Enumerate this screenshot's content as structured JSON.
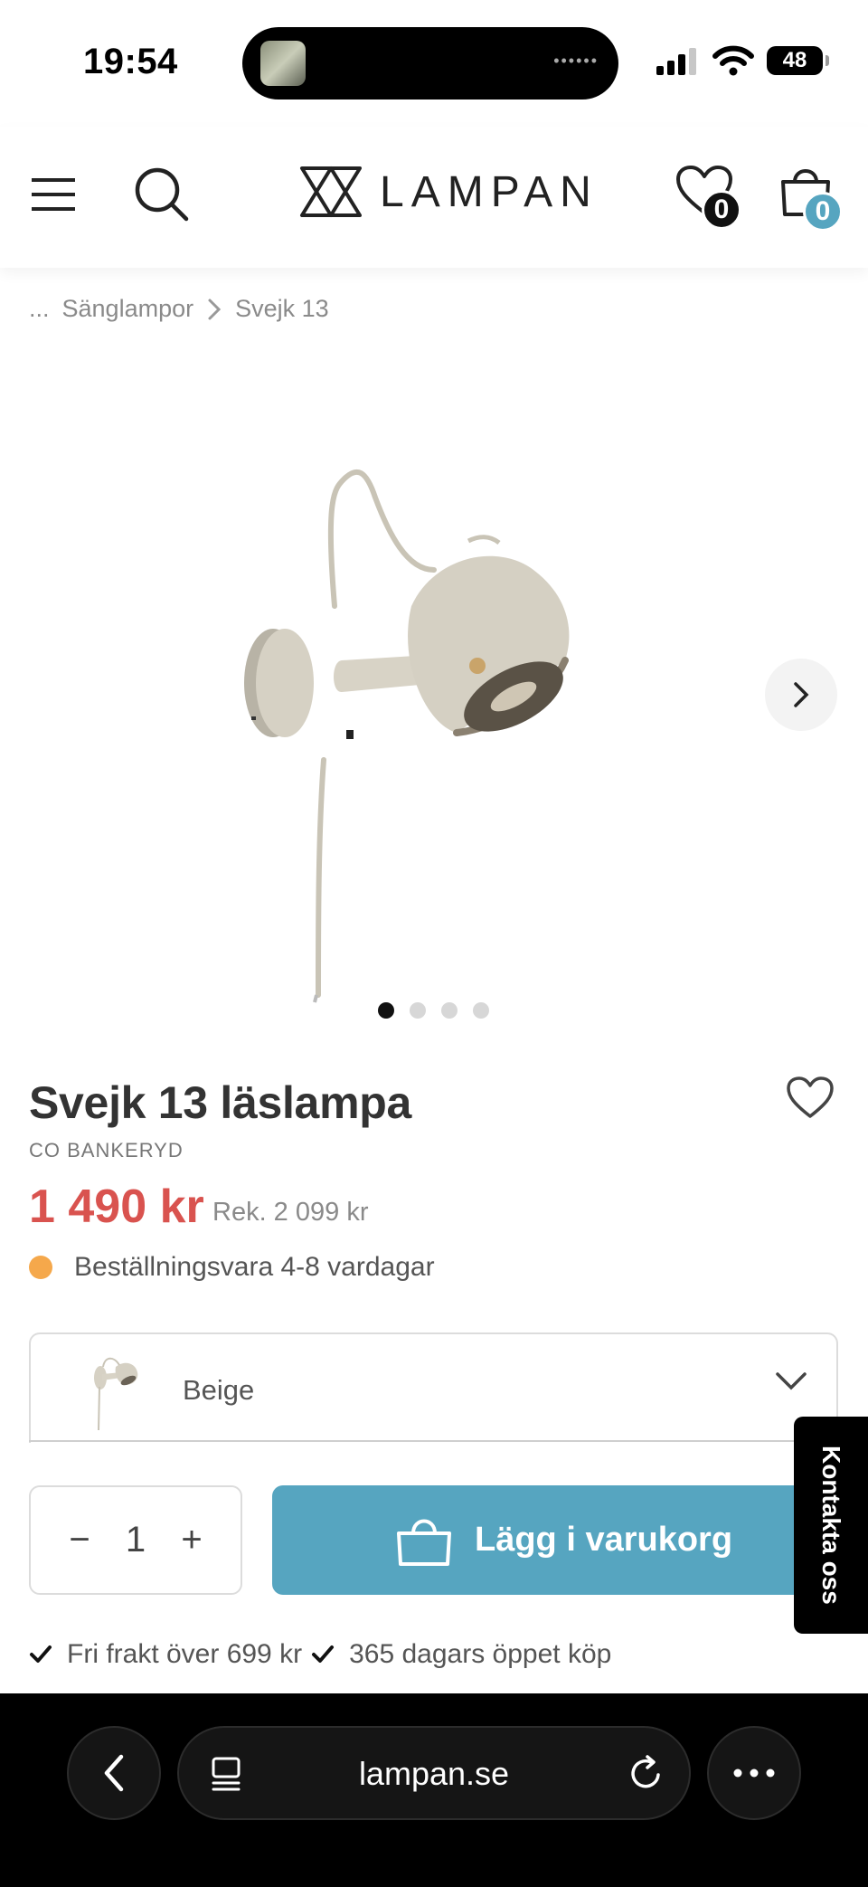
{
  "status": {
    "time": "19:54",
    "battery": "48"
  },
  "header": {
    "logo_text": "LAMPAN",
    "wishlist_count": "0",
    "cart_count": "0"
  },
  "breadcrumb": {
    "ellipsis": "...",
    "category": "Sänglampor",
    "current": "Svejk 13"
  },
  "gallery": {
    "image_count": 4,
    "active_index": 0
  },
  "product": {
    "title": "Svejk 13 läslampa",
    "brand": "CO BANKERYD",
    "price": "1 490 kr",
    "rek_price": "Rek. 2 099 kr",
    "stock_text": "Beställningsvara 4-8 vardagar",
    "stock_color": "#f5a84b"
  },
  "variant": {
    "selected": "Beige"
  },
  "purchase": {
    "quantity": "1",
    "minus": "−",
    "plus": "+",
    "add_to_cart": "Lägg i varukorg"
  },
  "perks": [
    "Fri frakt över 699 kr",
    "365 dagars öppet köp"
  ],
  "contact": {
    "label": "Kontakta oss"
  },
  "browser": {
    "url": "lampan.se"
  },
  "colors": {
    "accent": "#56a5c0",
    "sale": "#d9534f",
    "dark": "#111111"
  }
}
